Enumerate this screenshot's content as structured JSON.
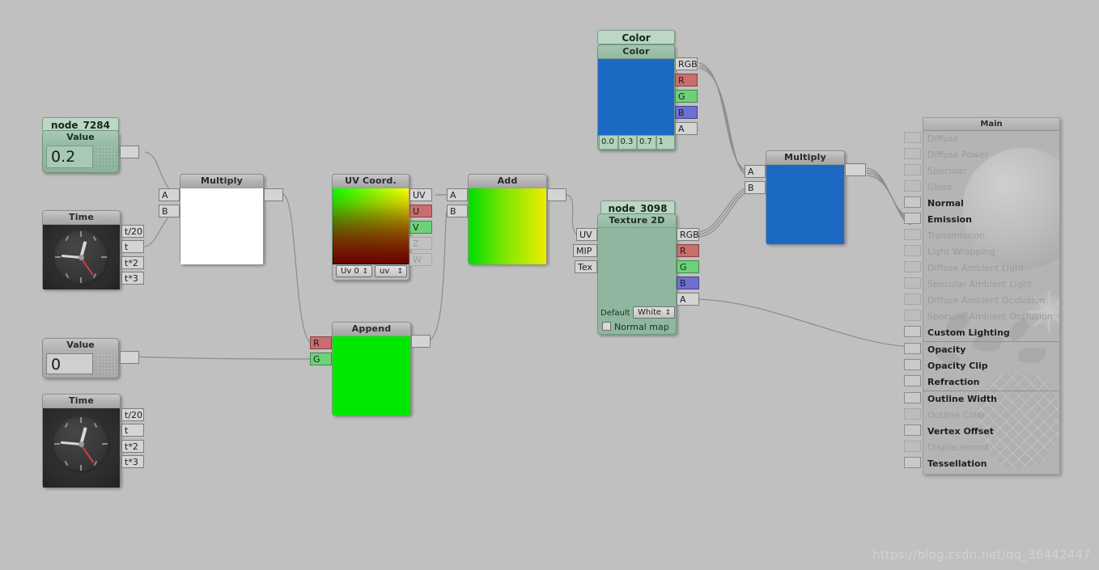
{
  "app": {
    "background_color": "#c0c0c0",
    "watermark": "https://blog.csdn.net/qq_36442447"
  },
  "nodes": {
    "value_green": {
      "title": "node_7284",
      "header": "Value",
      "value": "0.2",
      "out_port": ""
    },
    "time_top": {
      "header": "Time",
      "outputs": [
        "t/20",
        "t",
        "t*2",
        "t*3"
      ]
    },
    "value_plain": {
      "header": "Value",
      "value": "0",
      "out_port": ""
    },
    "time_bottom": {
      "header": "Time",
      "outputs": [
        "t/20",
        "t",
        "t*2",
        "t*3"
      ]
    },
    "multiply_left": {
      "header": "Multiply",
      "inputs": [
        "A",
        "B"
      ],
      "preview_color": "#ffffff",
      "out_port": ""
    },
    "uv_coord": {
      "header": "UV Coord.",
      "outputs": [
        "UV",
        "U",
        "V",
        "Z",
        "W"
      ],
      "dropdown_channel": "Uv 0",
      "dropdown_set": "uv"
    },
    "append": {
      "header": "Append",
      "inputs": [
        "R",
        "G"
      ],
      "preview_color": "#00e800",
      "out_port": ""
    },
    "add": {
      "header": "Add",
      "inputs": [
        "A",
        "B"
      ],
      "preview_gradient_from": "#00dd00",
      "preview_gradient_to": "#eded00",
      "out_port": ""
    },
    "texture2d": {
      "title": "node_3098",
      "header": "Texture 2D",
      "inputs": [
        "UV",
        "MIP",
        "Tex"
      ],
      "outputs": [
        "RGB",
        "R",
        "G",
        "B",
        "A"
      ],
      "default_label": "Default",
      "default_value": "White",
      "normal_map_label": "Normal map",
      "normal_map_checked": false
    },
    "color": {
      "title": "Color",
      "header": "Color",
      "outputs": [
        "RGB",
        "R",
        "G",
        "B",
        "A"
      ],
      "swatch_color": "#1c69c4",
      "channels": [
        "0.0",
        "0.3",
        "0.7",
        "1"
      ]
    },
    "multiply_right": {
      "header": "Multiply",
      "inputs": [
        "A",
        "B"
      ],
      "preview_color": "#1c69c4",
      "out_port": ""
    }
  },
  "main_panel": {
    "title": "Main",
    "rows": [
      {
        "label": "Diffuse",
        "active": false
      },
      {
        "label": "Diffuse Power",
        "active": false
      },
      {
        "label": "Specular",
        "active": false
      },
      {
        "label": "Gloss",
        "active": false
      },
      {
        "label": "Normal",
        "active": true
      },
      {
        "label": "Emission",
        "active": true
      },
      {
        "label": "Transmission",
        "active": false
      },
      {
        "label": "Light Wrapping",
        "active": false
      },
      {
        "label": "Diffuse Ambient Light",
        "active": false
      },
      {
        "label": "Specular Ambient Light",
        "active": false
      },
      {
        "label": "Diffuse Ambient Occlusion",
        "active": false
      },
      {
        "label": "Specular Ambient Occlusion",
        "active": false
      },
      {
        "label": "Custom Lighting",
        "active": true
      },
      {
        "label": "Opacity",
        "active": true
      },
      {
        "label": "Opacity Clip",
        "active": true
      },
      {
        "label": "Refraction",
        "active": true
      },
      {
        "label": "Outline Width",
        "active": true
      },
      {
        "label": "Outline Color",
        "active": false
      },
      {
        "label": "Vertex Offset",
        "active": true
      },
      {
        "label": "Displacement",
        "active": false
      },
      {
        "label": "Tessellation",
        "active": true
      }
    ],
    "separators_after": [
      12,
      15
    ]
  }
}
